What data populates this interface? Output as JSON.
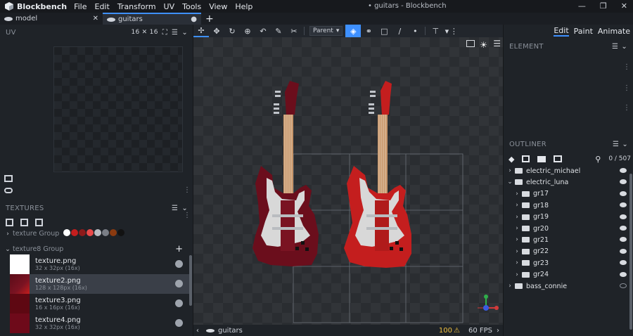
{
  "app": {
    "name": "Blockbench",
    "menu": [
      "File",
      "Edit",
      "Transform",
      "UV",
      "Tools",
      "View",
      "Help"
    ],
    "window_title": "• guitars - Blockbench"
  },
  "tabs": [
    {
      "label": "model",
      "close": "✕"
    },
    {
      "label": "guitars",
      "close": "●"
    }
  ],
  "new_tab": "+",
  "uv": {
    "title": "UV",
    "size": "16 ✕ 16"
  },
  "textures": {
    "title": "TEXTURES",
    "group1": "texture Group",
    "group2": "texture8 Group",
    "items": [
      {
        "name": "texture.png",
        "meta": "32 x 32px (16x)"
      },
      {
        "name": "texture2.png",
        "meta": "128 x 128px (16x)"
      },
      {
        "name": "texture3.png",
        "meta": "16 x 16px (16x)"
      },
      {
        "name": "texture4.png",
        "meta": "32 x 32px (16x)"
      }
    ],
    "swatch_colors": [
      "#ffffff",
      "#c41e1e",
      "#8e1a1a",
      "#e84a4a",
      "#b8bcc2",
      "#7a7e86",
      "#8a3a10",
      "#121212"
    ]
  },
  "toolbar": {
    "parent_label": "Parent"
  },
  "viewport": {
    "footer_label": "guitars",
    "triangle_count": "100",
    "fps": "60 FPS"
  },
  "right": {
    "modes": [
      "Edit",
      "Paint",
      "Animate"
    ],
    "element_title": "ELEMENT",
    "outliner_title": "OUTLINER",
    "outliner_count": "0 / 507",
    "outliner": [
      {
        "label": "electric_michael",
        "depth": 0,
        "open": false
      },
      {
        "label": "electric_luna",
        "depth": 0,
        "open": true
      },
      {
        "label": "gr17",
        "depth": 1,
        "open": false
      },
      {
        "label": "gr18",
        "depth": 1,
        "open": false
      },
      {
        "label": "gr19",
        "depth": 1,
        "open": false
      },
      {
        "label": "gr20",
        "depth": 1,
        "open": false
      },
      {
        "label": "gr21",
        "depth": 1,
        "open": false
      },
      {
        "label": "gr22",
        "depth": 1,
        "open": false
      },
      {
        "label": "gr23",
        "depth": 1,
        "open": false
      },
      {
        "label": "gr24",
        "depth": 1,
        "open": false
      },
      {
        "label": "bass_connie",
        "depth": 0,
        "open": false,
        "hidden": true
      }
    ]
  },
  "colors": {
    "accent": "#3e90ff",
    "guitar_left_body": "#6b0e1c",
    "guitar_right_body": "#c41e1e",
    "pickguard": "#d8d8d8",
    "neck": "#c8966a"
  }
}
